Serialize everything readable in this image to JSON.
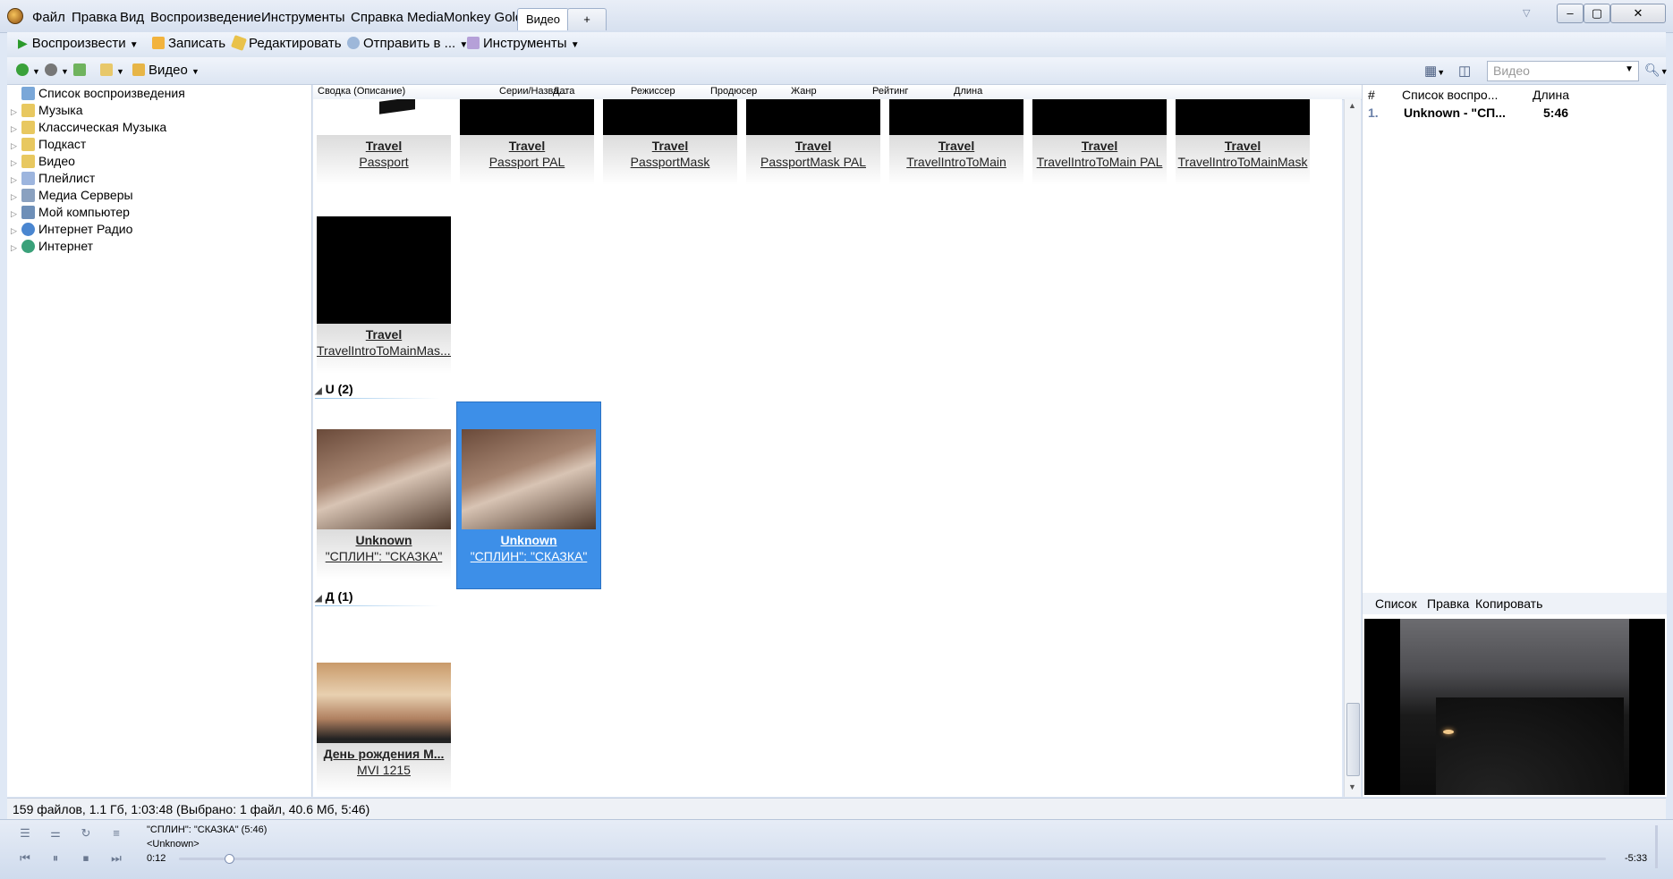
{
  "menubar": {
    "items": [
      "Файл",
      "Правка",
      "Вид",
      "Воспроизведение",
      "Инструменты",
      "Справка",
      "MediaMonkey Gold"
    ],
    "tabs": [
      {
        "label": "Видео",
        "active": true
      },
      {
        "label": "+",
        "active": false
      }
    ]
  },
  "toolbar": {
    "play": "Воспроизвести",
    "burn": "Записать",
    "edit": "Редактировать",
    "send": "Отправить в ...",
    "tools": "Инструменты",
    "breadcrumb": "Видео",
    "search_placeholder": "Видео"
  },
  "tree": {
    "items": [
      {
        "label": "Список воспроизведения",
        "icon": "playlist-icon"
      },
      {
        "label": "Музыка",
        "icon": "music-icon"
      },
      {
        "label": "Классическая Музыка",
        "icon": "music-icon"
      },
      {
        "label": "Подкаст",
        "icon": "podcast-icon"
      },
      {
        "label": "Видео",
        "icon": "video-icon"
      },
      {
        "label": "Плейлист",
        "icon": "playlist-file-icon"
      },
      {
        "label": "Медиа Серверы",
        "icon": "server-icon"
      },
      {
        "label": "Мой компьютер",
        "icon": "computer-icon"
      },
      {
        "label": "Интернет Радио",
        "icon": "radio-icon"
      },
      {
        "label": "Интернет",
        "icon": "internet-icon"
      }
    ]
  },
  "columns": [
    "Сводка (Описание)",
    "Серии/Назва...",
    "Дата",
    "Режиссер",
    "Продюсер",
    "Жанр",
    "Рейтинг",
    "Длина"
  ],
  "grid": {
    "row1": [
      {
        "title": "Travel",
        "name": "Passport"
      },
      {
        "title": "Travel",
        "name": "Passport PAL"
      },
      {
        "title": "Travel",
        "name": "PassportMask"
      },
      {
        "title": "Travel",
        "name": "PassportMask PAL"
      },
      {
        "title": "Travel",
        "name": "TravelIntroToMain"
      },
      {
        "title": "Travel",
        "name": "TravelIntroToMain PAL"
      },
      {
        "title": "Travel",
        "name": "TravelIntroToMainMask"
      }
    ],
    "row2": [
      {
        "title": "Travel",
        "name": "TravelIntroToMainMas...."
      }
    ],
    "group_u": "U (2)",
    "row3": [
      {
        "title": "Unknown",
        "name": "\"СПЛИН\": \"СКАЗКА\""
      },
      {
        "title": "Unknown",
        "name": "\"СПЛИН\": \"СКАЗКА\"",
        "selected": true
      }
    ],
    "group_d": "Д (1)",
    "row4": [
      {
        "title": "День рождения М...",
        "name": "MVI 1215"
      }
    ]
  },
  "playlist": {
    "headers": {
      "num": "#",
      "title": "Список воспро...",
      "length": "Длина"
    },
    "rows": [
      {
        "num": "1.",
        "title": "Unknown - \"СП...",
        "length": "5:46"
      }
    ],
    "tools": [
      "Список",
      "Правка",
      "Копировать"
    ]
  },
  "status": "159 файлов, 1.1 Гб, 1:03:48 (Выбрано: 1 файл, 40.6 Мб, 5:46)",
  "player": {
    "track": "\"СПЛИН\": \"СКАЗКА\" (5:46)",
    "artist": "<Unknown>",
    "elapsed": "0:12",
    "remaining": "-5:33",
    "progress_fraction": 0.035
  },
  "colors": {
    "selection": "#3d8fe8",
    "panel": "#dfe8f5"
  }
}
